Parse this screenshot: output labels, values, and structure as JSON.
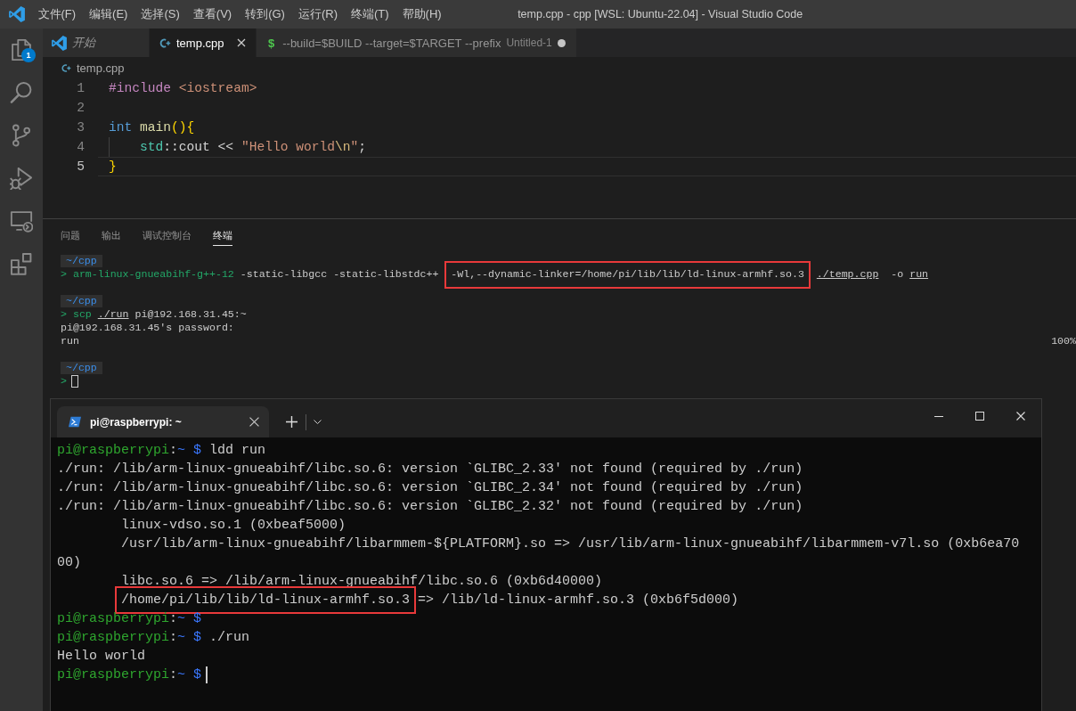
{
  "title_bar": {
    "menu": [
      "文件(F)",
      "编辑(E)",
      "选择(S)",
      "查看(V)",
      "转到(G)",
      "运行(R)",
      "终端(T)",
      "帮助(H)"
    ],
    "title": "temp.cpp - cpp [WSL: Ubuntu-22.04] - Visual Studio Code"
  },
  "activity_bar": [
    {
      "kind": "explorer",
      "badge": "1"
    },
    {
      "kind": "search"
    },
    {
      "kind": "source_control"
    },
    {
      "kind": "run_debug"
    },
    {
      "kind": "remote"
    },
    {
      "kind": "extensions"
    }
  ],
  "tabs": [
    {
      "kind": "vscode",
      "label": "开始",
      "preview": true,
      "selected": false,
      "dirty": false
    },
    {
      "kind": "cpp",
      "label": "temp.cpp",
      "preview": false,
      "selected": true,
      "dirty": false
    },
    {
      "kind": "shell",
      "glyph": "$",
      "label": "--build=$BUILD --target=$TARGET --prefix",
      "description": "Untitled-1",
      "preview": false,
      "selected": false,
      "dirty": true
    }
  ],
  "breadcrumb": {
    "kind": "cpp",
    "label": "temp.cpp"
  },
  "editor": {
    "lines": [
      {
        "number": "1",
        "current": false,
        "tokens": [
          {
            "kind": "preproc",
            "text": "#include "
          },
          {
            "kind": "string",
            "text": "<iostream>"
          }
        ]
      },
      {
        "number": "2",
        "current": false
      },
      {
        "number": "3",
        "current": false,
        "tokens": [
          {
            "kind": "keyword",
            "text": "int "
          },
          {
            "kind": "function",
            "text": "main"
          },
          {
            "kind": "bracket",
            "text": "(){"
          }
        ]
      },
      {
        "number": "4",
        "current": false,
        "tokens": [
          {
            "kind": "indent"
          },
          {
            "kind": "namespace",
            "text": "std"
          },
          {
            "kind": "plain",
            "text": "::cout << "
          },
          {
            "kind": "string",
            "text": "\"Hello world"
          },
          {
            "kind": "escape",
            "text": "\\n"
          },
          {
            "kind": "string",
            "text": "\""
          },
          {
            "kind": "plain",
            "text": ";"
          }
        ]
      },
      {
        "number": "5",
        "current": true,
        "tokens": [
          {
            "kind": "bracket",
            "text": "}"
          }
        ]
      }
    ]
  },
  "panel": {
    "tabs": [
      {
        "label": "问题",
        "selected": false
      },
      {
        "label": "输出",
        "selected": false
      },
      {
        "label": "调试控制台",
        "selected": false
      },
      {
        "label": "终端",
        "selected": true
      }
    ],
    "terminal": {
      "lines": [
        {
          "kind": "cwd",
          "text": "~/cpp"
        },
        {
          "kind": "text",
          "segments": [
            {
              "kind": "prompt",
              "text": "> "
            },
            {
              "kind": "program",
              "text": "arm-linux-gnueabihf-g++-12"
            },
            {
              "kind": "plain",
              "text": " -static-libgcc -static-libstdc++"
            },
            {
              "kind": "boxed",
              "text": "-Wl,--dynamic-linker=/home/pi/lib/lib/ld-linux-armhf.so.3"
            },
            {
              "kind": "link",
              "text": "./temp.cpp"
            },
            {
              "kind": "plain",
              "text": "  -o "
            },
            {
              "kind": "link",
              "text": "run"
            }
          ]
        },
        {
          "kind": "blank"
        },
        {
          "kind": "cwd",
          "text": "~/cpp"
        },
        {
          "kind": "text",
          "segments": [
            {
              "kind": "prompt",
              "text": "> "
            },
            {
              "kind": "program",
              "text": "scp"
            },
            {
              "kind": "link",
              "text": "./run"
            },
            {
              "kind": "plain",
              "text": " pi@192.168.31.45:~"
            }
          ]
        },
        {
          "kind": "text",
          "segments": [
            {
              "kind": "plain",
              "text": "pi@192.168.31.45's password:"
            }
          ]
        },
        {
          "kind": "progress",
          "text": "run",
          "percent": "100%"
        },
        {
          "kind": "blank"
        },
        {
          "kind": "cwd",
          "text": "~/cpp"
        },
        {
          "kind": "input",
          "segments": [
            {
              "kind": "prompt",
              "text": ">"
            }
          ]
        }
      ]
    }
  },
  "terminal_window": {
    "tab_title": "pi@raspberrypi: ~",
    "lines": [
      {
        "kind": "text",
        "segments": [
          {
            "kind": "user",
            "text": "pi@raspberrypi"
          },
          {
            "kind": "plain",
            "text": ":"
          },
          {
            "kind": "path",
            "text": "~ $"
          },
          {
            "kind": "plain",
            "text": " ldd run"
          }
        ]
      },
      {
        "kind": "text",
        "segments": [
          {
            "kind": "plain",
            "text": "./run: /lib/arm-linux-gnueabihf/libc.so.6: version `GLIBC_2.33' not found (required by ./run)"
          }
        ]
      },
      {
        "kind": "text",
        "segments": [
          {
            "kind": "plain",
            "text": "./run: /lib/arm-linux-gnueabihf/libc.so.6: version `GLIBC_2.34' not found (required by ./run)"
          }
        ]
      },
      {
        "kind": "text",
        "segments": [
          {
            "kind": "plain",
            "text": "./run: /lib/arm-linux-gnueabihf/libc.so.6: version `GLIBC_2.32' not found (required by ./run)"
          }
        ]
      },
      {
        "kind": "detail",
        "segments": [
          {
            "kind": "plain",
            "text": "linux-vdso.so.1 (0xbeaf5000)"
          }
        ]
      },
      {
        "kind": "detail",
        "segments": [
          {
            "kind": "plain",
            "text": "/usr/lib/arm-linux-gnueabihf/libarmmem-${PLATFORM}.so => /usr/lib/arm-linux-gnueabihf/libarmmem-v7l.so (0xb6ea70"
          }
        ]
      },
      {
        "kind": "text",
        "segments": [
          {
            "kind": "plain",
            "text": "00)"
          }
        ]
      },
      {
        "kind": "detail",
        "segments": [
          {
            "kind": "plain",
            "text": "libc.so.6 => /lib/arm-linux-gnueabihf/libc.so.6 (0xb6d40000)"
          }
        ]
      },
      {
        "kind": "detail",
        "segments": [
          {
            "kind": "boxed",
            "text": "/home/pi/lib/lib/ld-linux-armhf.so.3"
          },
          {
            "kind": "plain",
            "text": " => /lib/ld-linux-armhf.so.3 (0xb6f5d000)"
          }
        ]
      },
      {
        "kind": "text",
        "segments": [
          {
            "kind": "user",
            "text": "pi@raspberrypi"
          },
          {
            "kind": "plain",
            "text": ":"
          },
          {
            "kind": "path",
            "text": "~ $"
          }
        ]
      },
      {
        "kind": "text",
        "segments": [
          {
            "kind": "user",
            "text": "pi@raspberrypi"
          },
          {
            "kind": "plain",
            "text": ":"
          },
          {
            "kind": "path",
            "text": "~ $"
          },
          {
            "kind": "plain",
            "text": " ./run"
          }
        ]
      },
      {
        "kind": "text",
        "segments": [
          {
            "kind": "plain",
            "text": "Hello world"
          }
        ]
      },
      {
        "kind": "input",
        "segments": [
          {
            "kind": "user",
            "text": "pi@raspberrypi"
          },
          {
            "kind": "plain",
            "text": ":"
          },
          {
            "kind": "path",
            "text": "~ $"
          }
        ]
      }
    ]
  }
}
